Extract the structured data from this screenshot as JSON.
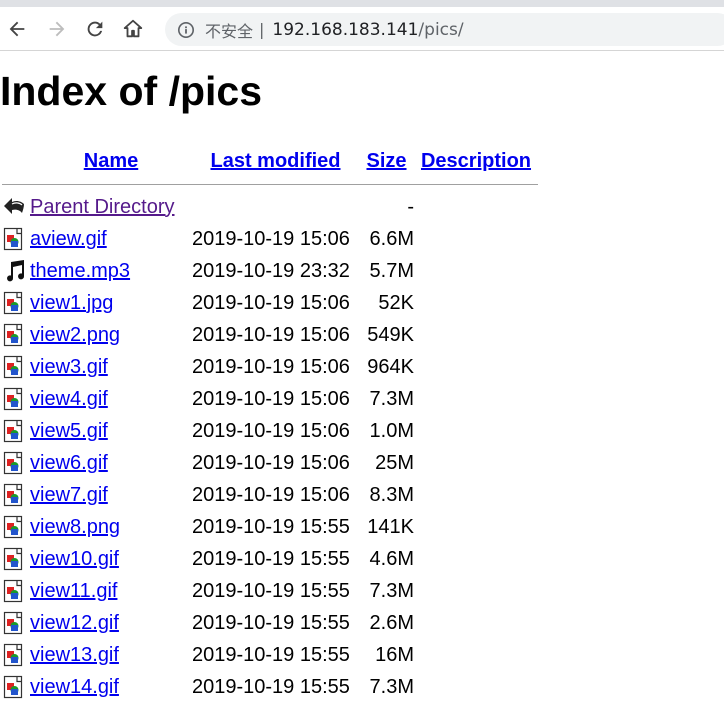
{
  "browser": {
    "security_label": "不安全",
    "separator": "|",
    "url_host": "192.168.183.141",
    "url_path": "/pics/"
  },
  "page": {
    "title": "Index of /pics"
  },
  "table": {
    "headers": {
      "name": "Name",
      "last_modified": "Last modified",
      "size": "Size",
      "description": "Description"
    },
    "parent": {
      "label": "Parent Directory",
      "size": "-"
    },
    "rows": [
      {
        "name": "aview.gif",
        "modified": "2019-10-19 15:06",
        "size": "6.6M",
        "icon": "image-icon"
      },
      {
        "name": "theme.mp3",
        "modified": "2019-10-19 23:32",
        "size": "5.7M",
        "icon": "sound-icon"
      },
      {
        "name": "view1.jpg",
        "modified": "2019-10-19 15:06",
        "size": "52K",
        "icon": "image-icon"
      },
      {
        "name": "view2.png",
        "modified": "2019-10-19 15:06",
        "size": "549K",
        "icon": "image-icon"
      },
      {
        "name": "view3.gif",
        "modified": "2019-10-19 15:06",
        "size": "964K",
        "icon": "image-icon"
      },
      {
        "name": "view4.gif",
        "modified": "2019-10-19 15:06",
        "size": "7.3M",
        "icon": "image-icon"
      },
      {
        "name": "view5.gif",
        "modified": "2019-10-19 15:06",
        "size": "1.0M",
        "icon": "image-icon"
      },
      {
        "name": "view6.gif",
        "modified": "2019-10-19 15:06",
        "size": "25M",
        "icon": "image-icon"
      },
      {
        "name": "view7.gif",
        "modified": "2019-10-19 15:06",
        "size": "8.3M",
        "icon": "image-icon"
      },
      {
        "name": "view8.png",
        "modified": "2019-10-19 15:55",
        "size": "141K",
        "icon": "image-icon"
      },
      {
        "name": "view10.gif",
        "modified": "2019-10-19 15:55",
        "size": "4.6M",
        "icon": "image-icon"
      },
      {
        "name": "view11.gif",
        "modified": "2019-10-19 15:55",
        "size": "7.3M",
        "icon": "image-icon"
      },
      {
        "name": "view12.gif",
        "modified": "2019-10-19 15:55",
        "size": "2.6M",
        "icon": "image-icon"
      },
      {
        "name": "view13.gif",
        "modified": "2019-10-19 15:55",
        "size": "16M",
        "icon": "image-icon"
      },
      {
        "name": "view14.gif",
        "modified": "2019-10-19 15:55",
        "size": "7.3M",
        "icon": "image-icon"
      }
    ]
  },
  "colors": {
    "link": "#0000ee",
    "visited_link": "#551a8b"
  }
}
